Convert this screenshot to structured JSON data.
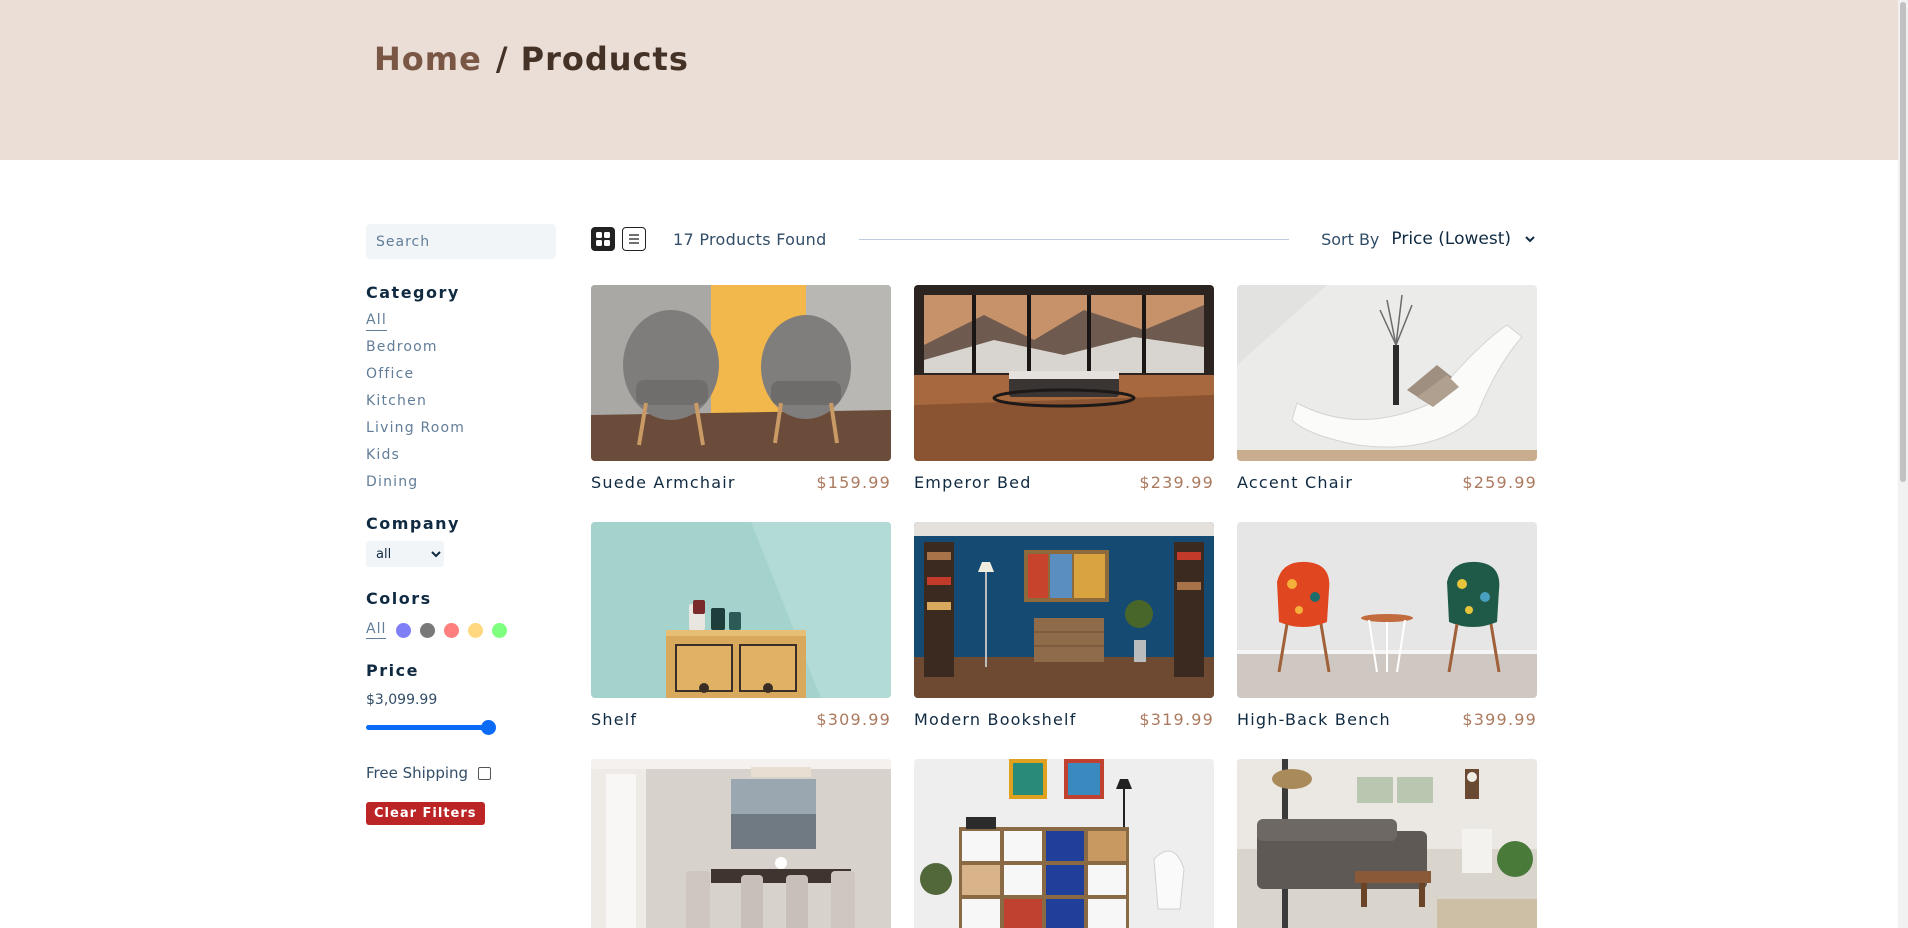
{
  "breadcrumb": {
    "home": "Home",
    "current": "/ Products"
  },
  "filters": {
    "search_placeholder": "Search",
    "category_title": "Category",
    "categories": [
      "All",
      "Bedroom",
      "Office",
      "Kitchen",
      "Living Room",
      "Kids",
      "Dining"
    ],
    "active_category": "All",
    "company_title": "Company",
    "company_selected": "all",
    "colors_title": "Colors",
    "colors_all": "All",
    "colors": [
      "#7f7ff7",
      "#797979",
      "#ff7f7f",
      "#ffd87f",
      "#7fff7f"
    ],
    "price_title": "Price",
    "price_value": "$3,099.99",
    "price_level": 1.0,
    "free_shipping_label": "Free Shipping",
    "free_shipping_checked": false,
    "clear_label": "Clear Filters"
  },
  "toolbar": {
    "grid_view_icon": "grid-icon",
    "list_view_icon": "list-icon",
    "active_view": "grid",
    "found_text": "17 Products Found",
    "sort_label": "Sort By",
    "sort_selected": "Price (Lowest)"
  },
  "products": [
    {
      "name": "Suede Armchair",
      "price": "$159.99"
    },
    {
      "name": "Emperor Bed",
      "price": "$239.99"
    },
    {
      "name": "Accent Chair",
      "price": "$259.99"
    },
    {
      "name": "Shelf",
      "price": "$309.99"
    },
    {
      "name": "Modern Bookshelf",
      "price": "$319.99"
    },
    {
      "name": "High-Back Bench",
      "price": "$399.99"
    },
    {
      "name": "",
      "price": ""
    },
    {
      "name": "",
      "price": ""
    },
    {
      "name": "",
      "price": ""
    }
  ],
  "theme": {
    "hero_bg": "#eaded7",
    "brand_brown": "#795744",
    "price_color": "#ab7a5f",
    "danger": "#bb2525",
    "slider": "#0b6bf7"
  }
}
